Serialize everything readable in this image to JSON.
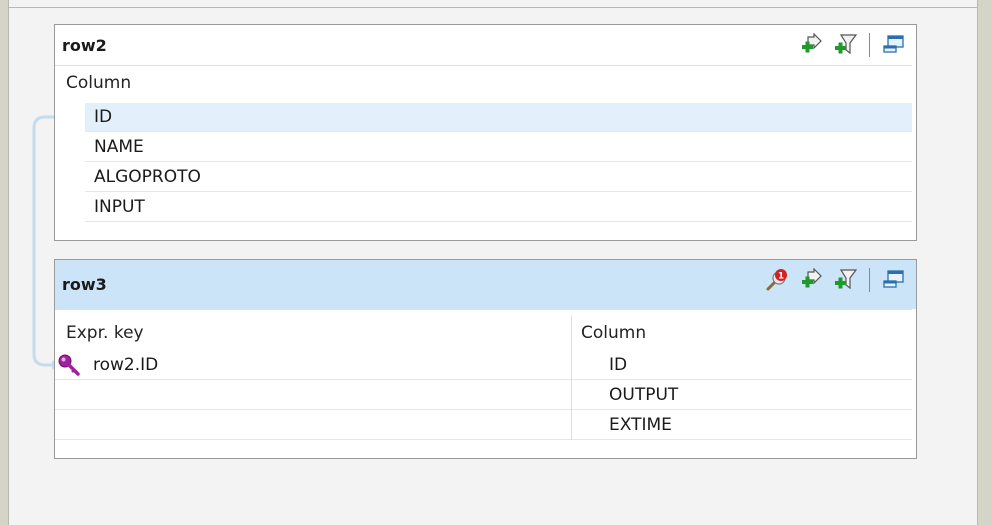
{
  "row2": {
    "title": "row2",
    "column_header": "Column",
    "columns": [
      "ID",
      "NAME",
      "ALGOPROTO",
      "INPUT"
    ],
    "selected_index": 0
  },
  "row3": {
    "title": "row3",
    "expr_header": "Expr. key",
    "column_header": "Column",
    "expr_keys": [
      "row2.ID"
    ],
    "columns": [
      "ID",
      "OUTPUT",
      "EXTIME"
    ],
    "warning_badge": "1"
  },
  "icons": {
    "add_input": "add-input-icon",
    "add_filter": "add-filter-icon",
    "minimize": "minimize-icon",
    "key": "key-icon",
    "search_warning": "search-warning-icon"
  },
  "colors": {
    "header_selected": "#cce4f7",
    "row_selected": "#e3f0fb",
    "connector": "#b9d7ee",
    "key": "#a020a0"
  }
}
